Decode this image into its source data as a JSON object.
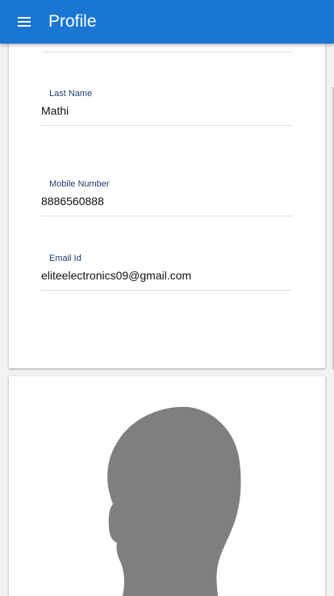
{
  "appbar": {
    "title": "Profile",
    "menu_icon": "menu-icon",
    "color": "#1976d2"
  },
  "form": {
    "fields": [
      {
        "label": "Last Name",
        "value": "Mathi"
      },
      {
        "label": "Mobile Number",
        "value": "8886560888"
      },
      {
        "label": "Email Id",
        "value": "eliteelectronics09@gmail.com"
      }
    ]
  },
  "photo": {
    "icon": "profile-silhouette-icon",
    "color": "#7f7f7f"
  }
}
